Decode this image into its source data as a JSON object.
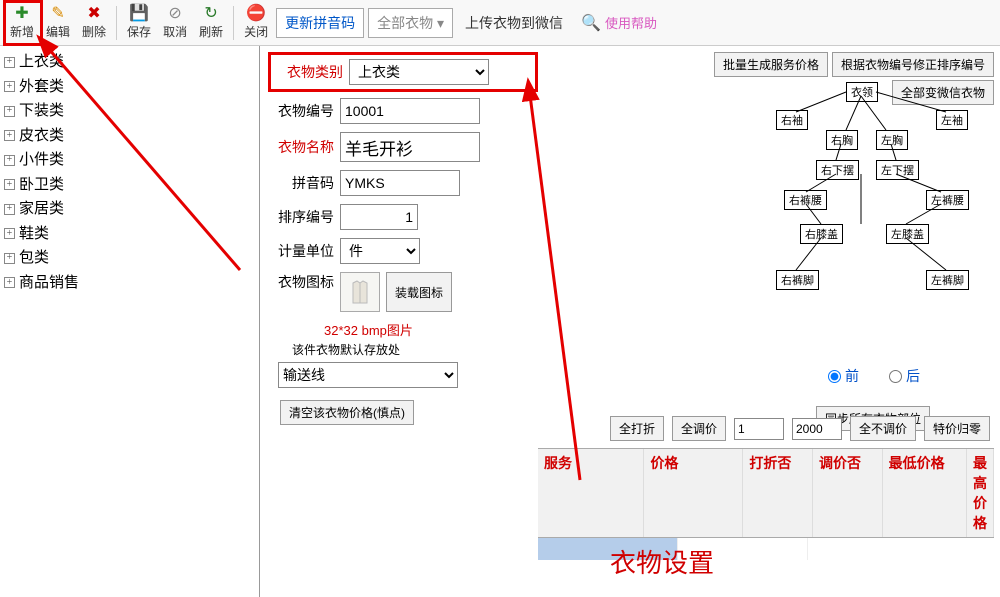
{
  "toolbar": {
    "add": "新增",
    "edit": "编辑",
    "delete": "删除",
    "save": "保存",
    "cancel": "取消",
    "refresh": "刷新",
    "close": "关闭",
    "update_pinyin": "更新拼音码",
    "all_clothes": "全部衣物",
    "upload_wechat": "上传衣物到微信",
    "help": "使用帮助"
  },
  "tree": {
    "items": [
      "上衣类",
      "外套类",
      "下装类",
      "皮衣类",
      "小件类",
      "卧卫类",
      "家居类",
      "鞋类",
      "包类",
      "商品销售"
    ]
  },
  "top_buttons": {
    "batch_gen": "批量生成服务价格",
    "fix_order": "根据衣物编号修正排序编号",
    "all_wechat": "全部变微信衣物"
  },
  "form": {
    "category_label": "衣物类别",
    "category_value": "上衣类",
    "code_label": "衣物编号",
    "code_value": "10001",
    "name_label": "衣物名称",
    "name_value": "羊毛开衫",
    "pinyin_label": "拼音码",
    "pinyin_value": "YMKS",
    "order_label": "排序编号",
    "order_value": "1",
    "unit_label": "计量单位",
    "unit_value": "件",
    "icon_label": "衣物图标",
    "load_icon_btn": "装载图标",
    "icon_caption": "32*32 bmp图片",
    "default_store_label": "该件衣物默认存放处",
    "default_store_value": "输送线",
    "clear_price_btn": "清空该衣物价格(慎点)"
  },
  "diagram": {
    "collar": "衣领",
    "r_sleeve": "右袖",
    "l_sleeve": "左袖",
    "r_chest": "右胸",
    "l_chest": "左胸",
    "r_hem": "右下摆",
    "l_hem": "左下摆",
    "r_pwaist": "右裤腰",
    "l_pwaist": "左裤腰",
    "r_knee": "右膝盖",
    "l_knee": "左膝盖",
    "r_pfoot": "右裤脚",
    "l_pfoot": "左裤脚"
  },
  "radios": {
    "front": "前",
    "back": "后"
  },
  "sync_parts_btn": "同步所有衣物部位",
  "pricebar": {
    "all_discount": "全打折",
    "all_adjust": "全调价",
    "v1": "1",
    "v2": "2000",
    "no_adjust": "全不调价",
    "special_zero": "特价归零"
  },
  "table": {
    "cols": [
      "服务",
      "价格",
      "打折否",
      "调价否",
      "最低价格",
      "最高价格"
    ]
  },
  "big_title": "衣物设置"
}
